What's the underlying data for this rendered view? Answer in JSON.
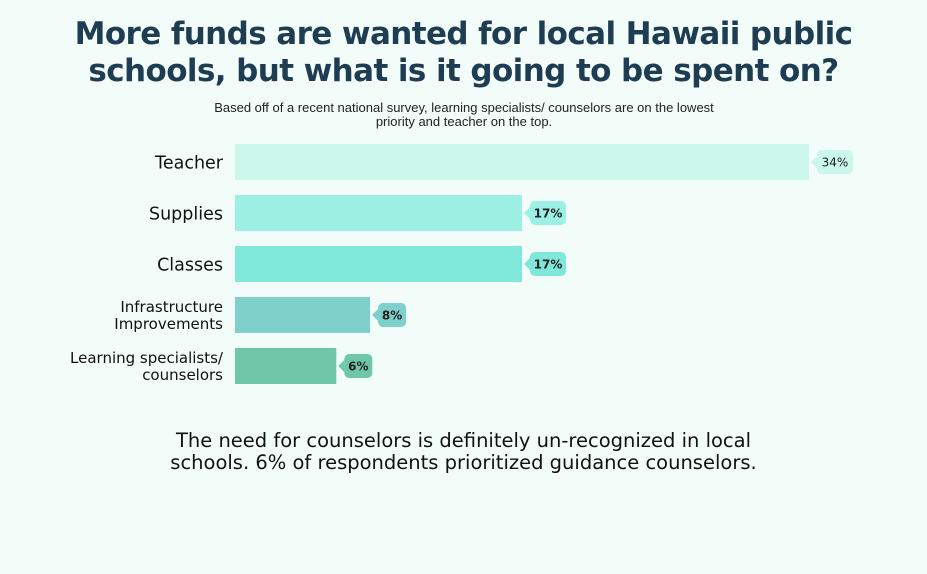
{
  "title": "More funds are wanted for local Hawaii public schools, but what is it going to be spent on?",
  "subtitle": "Based off of a recent national survey, learning specialists/ counselors are on the lowest priority and teacher on the top.",
  "note": "The need for counselors is definitely un-recognized in local schools. 6% of respondents prioritized guidance counselors.",
  "chart_data": {
    "type": "bar",
    "orientation": "horizontal",
    "title": "More funds are wanted for local Hawaii public schools, but what is it going to be spent on?",
    "xlabel": "",
    "ylabel": "",
    "grid": false,
    "legend": "none",
    "xlim": [
      0,
      34
    ],
    "categories": [
      [
        "Teacher"
      ],
      [
        "Supplies"
      ],
      [
        "Classes"
      ],
      [
        "Infrastructure",
        "Improvements"
      ],
      [
        "Learning specialists/",
        "counselors"
      ]
    ],
    "values": [
      34,
      17,
      17,
      8,
      6
    ],
    "data_labels": [
      "34%",
      "17%",
      "17%",
      "8%",
      "6%"
    ],
    "colors": [
      "#cbf6ea",
      "#9cf1e4",
      "#7fe8da",
      "#7fcfcb",
      "#6fc6a8"
    ],
    "label_colors": [
      "#cbf6ea",
      "#9cf1e4",
      "#7fe8da",
      "#7fcfcb",
      "#6fc6a8"
    ]
  }
}
